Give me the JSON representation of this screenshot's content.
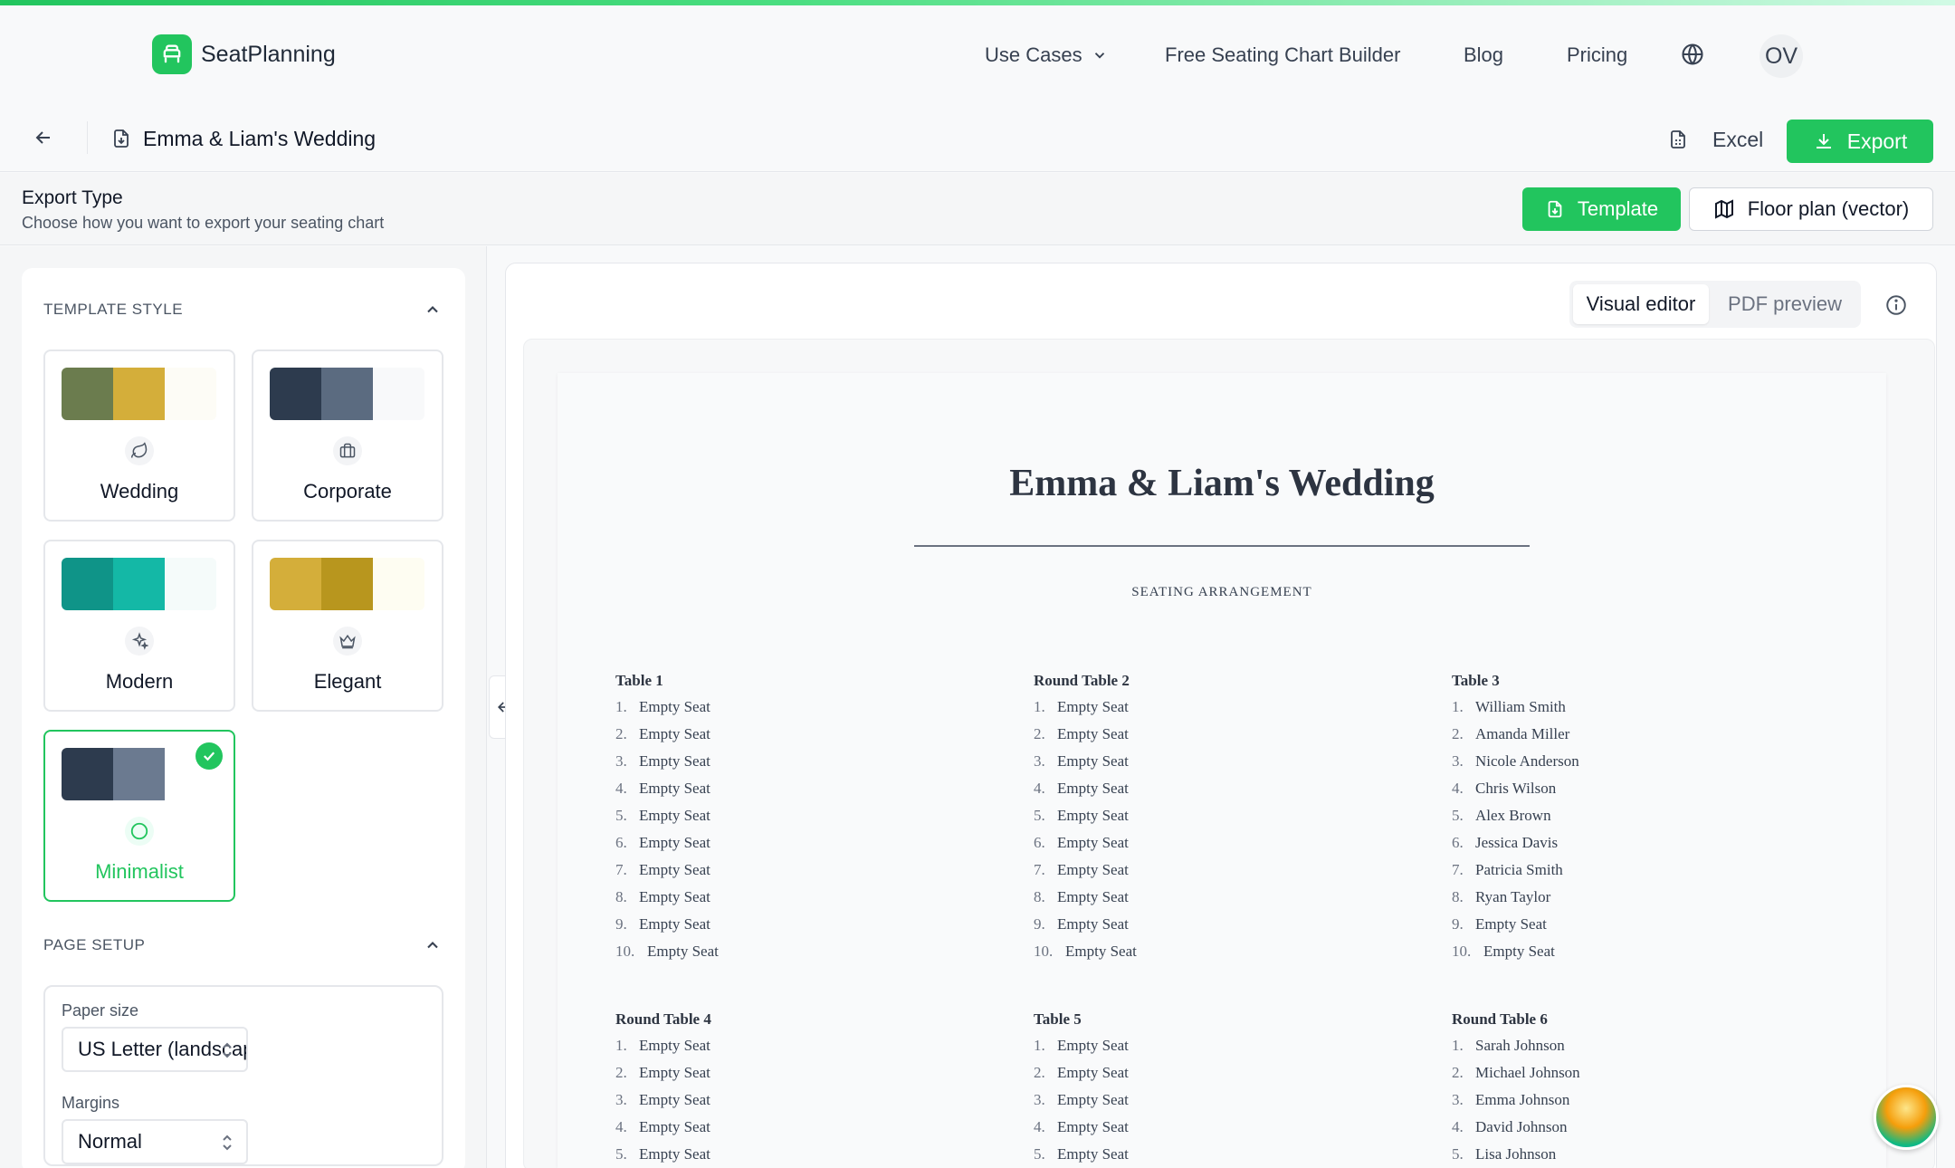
{
  "brand": {
    "name": "SeatPlanning",
    "accent": "#22c55e"
  },
  "nav": {
    "use_cases": "Use Cases",
    "builder": "Free Seating Chart Builder",
    "blog": "Blog",
    "pricing": "Pricing",
    "avatar": "OV"
  },
  "doc": {
    "title": "Emma & Liam's Wedding",
    "excel": "Excel",
    "export": "Export"
  },
  "export_type": {
    "title": "Export Type",
    "subtitle": "Choose how you want to export your seating chart",
    "template_label": "Template",
    "floor_label": "Floor plan (vector)"
  },
  "template_style": {
    "heading": "TEMPLATE STYLE",
    "cards": [
      {
        "label": "Wedding",
        "icon": "leaf-icon",
        "colors": [
          "#6b7c4e",
          "#d4ae3a",
          "#fdfcf6"
        ]
      },
      {
        "label": "Corporate",
        "icon": "briefcase-icon",
        "colors": [
          "#2d3b4e",
          "#5b6b80",
          "#f8f9fa"
        ]
      },
      {
        "label": "Modern",
        "icon": "sparkles-icon",
        "colors": [
          "#0f9488",
          "#14b8a6",
          "#f5fbfa"
        ]
      },
      {
        "label": "Elegant",
        "icon": "crown-icon",
        "colors": [
          "#d4ae3a",
          "#b8961e",
          "#fefdf2"
        ]
      },
      {
        "label": "Minimalist",
        "icon": "circle-icon",
        "colors": [
          "#2d3b4e",
          "#6b7a90",
          "#ffffff"
        ],
        "selected": true
      }
    ]
  },
  "page_setup": {
    "heading": "PAGE SETUP",
    "paper_label": "Paper size",
    "paper_value": "US Letter (landscape)",
    "margins_label": "Margins",
    "margins_value": "Normal"
  },
  "preview": {
    "visual_editor": "Visual editor",
    "pdf_preview": "PDF preview",
    "title": "Emma & Liam's Wedding",
    "subtitle": "SEATING ARRANGEMENT",
    "tables": [
      {
        "name": "Table 1",
        "seats": [
          "Empty Seat",
          "Empty Seat",
          "Empty Seat",
          "Empty Seat",
          "Empty Seat",
          "Empty Seat",
          "Empty Seat",
          "Empty Seat",
          "Empty Seat",
          "Empty Seat"
        ]
      },
      {
        "name": "Round Table 2",
        "seats": [
          "Empty Seat",
          "Empty Seat",
          "Empty Seat",
          "Empty Seat",
          "Empty Seat",
          "Empty Seat",
          "Empty Seat",
          "Empty Seat",
          "Empty Seat",
          "Empty Seat"
        ]
      },
      {
        "name": "Table 3",
        "seats": [
          "William Smith",
          "Amanda Miller",
          "Nicole Anderson",
          "Chris Wilson",
          "Alex Brown",
          "Jessica Davis",
          "Patricia Smith",
          "Ryan Taylor",
          "Empty Seat",
          "Empty Seat"
        ]
      },
      {
        "name": "Round Table 4",
        "seats": [
          "Empty Seat",
          "Empty Seat",
          "Empty Seat",
          "Empty Seat",
          "Empty Seat"
        ]
      },
      {
        "name": "Table 5",
        "seats": [
          "Empty Seat",
          "Empty Seat",
          "Empty Seat",
          "Empty Seat",
          "Empty Seat"
        ]
      },
      {
        "name": "Round Table 6",
        "seats": [
          "Sarah Johnson",
          "Michael Johnson",
          "Emma Johnson",
          "David Johnson",
          "Lisa Johnson"
        ]
      }
    ]
  }
}
